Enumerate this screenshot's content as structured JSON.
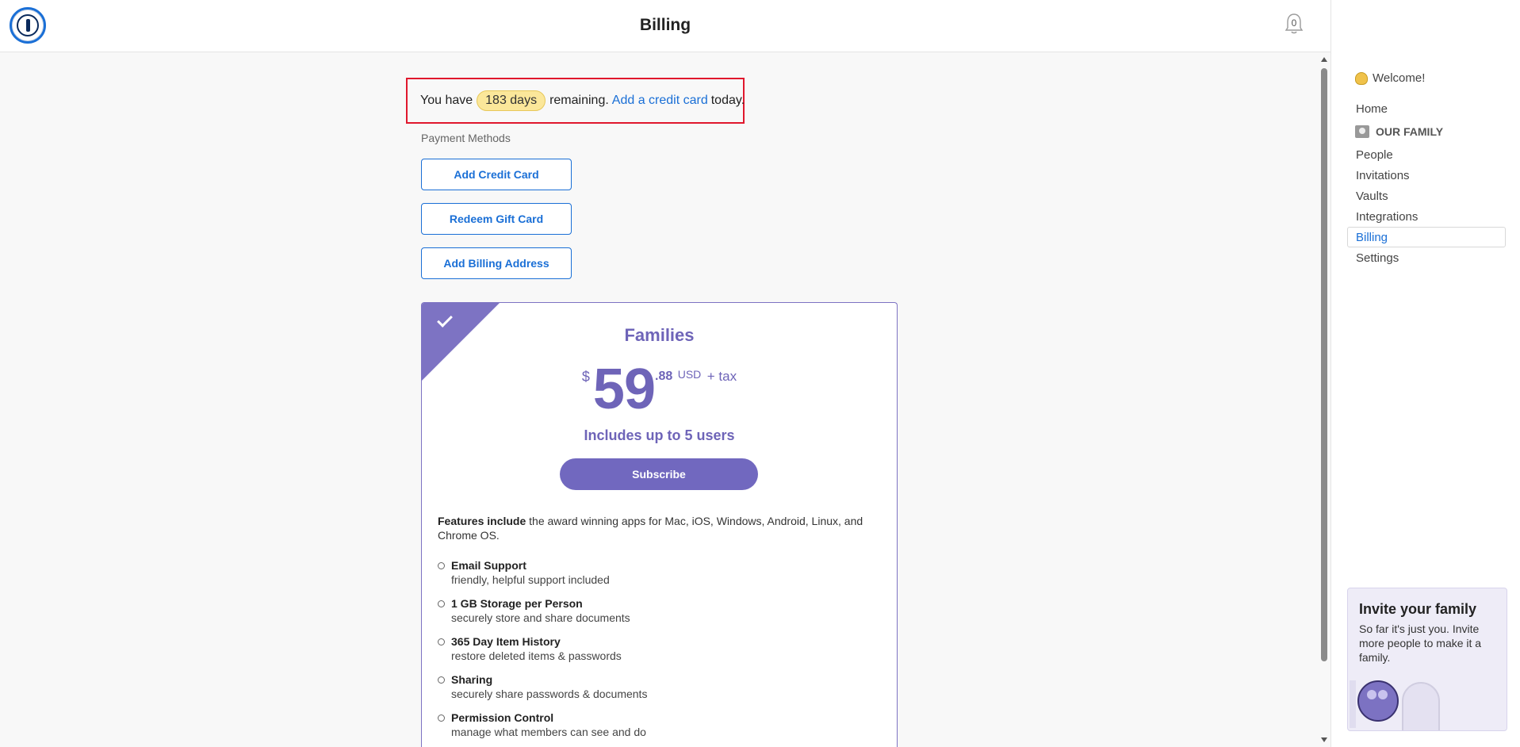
{
  "header": {
    "title": "Billing",
    "notification_count": "0"
  },
  "notice": {
    "prefix": "You have",
    "days": "183 days",
    "middle": "remaining.",
    "link": "Add a credit card",
    "suffix": "today."
  },
  "payment_methods": {
    "label": "Payment Methods",
    "buttons": [
      "Add Credit Card",
      "Redeem Gift Card",
      "Add Billing Address"
    ]
  },
  "plan": {
    "name": "Families",
    "currency": "$",
    "price_whole": "59",
    "price_cents": ".88",
    "price_unit": "USD",
    "tax": "+ tax",
    "includes": "Includes up to 5 users",
    "subscribe": "Subscribe",
    "features_lead": "Features include",
    "features_text": "the award winning apps for Mac, iOS, Windows, Android, Linux, and Chrome OS.",
    "features": [
      {
        "title": "Email Support",
        "desc": "friendly, helpful support included"
      },
      {
        "title": "1 GB Storage per Person",
        "desc": "securely store and share documents"
      },
      {
        "title": "365 Day Item History",
        "desc": "restore deleted items & passwords"
      },
      {
        "title": "Sharing",
        "desc": "securely share passwords & documents"
      },
      {
        "title": "Permission Control",
        "desc": "manage what members can see and do"
      }
    ]
  },
  "sidebar": {
    "welcome": "Welcome!",
    "items": [
      {
        "label": "Home"
      },
      {
        "label": "OUR FAMILY"
      },
      {
        "label": "People"
      },
      {
        "label": "Invitations"
      },
      {
        "label": "Vaults"
      },
      {
        "label": "Integrations"
      },
      {
        "label": "Billing"
      },
      {
        "label": "Settings"
      }
    ],
    "invite": {
      "title": "Invite your family",
      "text": "So far it's just you. Invite more people to make it a family."
    }
  },
  "colors": {
    "accent": "#1a6fd6",
    "plan": "#7168bf",
    "highlight": "#fbe79a",
    "alert_border": "#e0182d"
  }
}
